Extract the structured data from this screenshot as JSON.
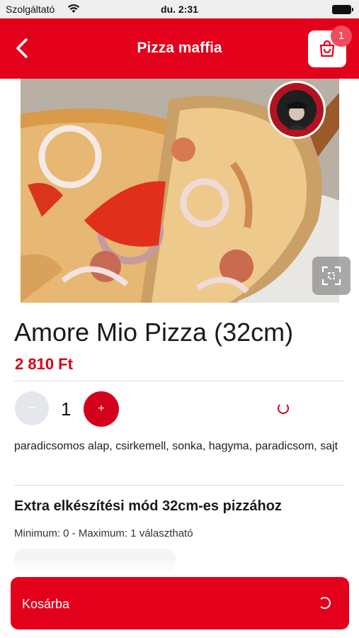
{
  "status_bar": {
    "carrier": "Szolgáltató",
    "time": "du. 2:31"
  },
  "header": {
    "title": "Pizza maffia",
    "cart_count": "1",
    "back_icon": "chevron-left-icon",
    "cart_icon": "shopping-bag-icon"
  },
  "product": {
    "name": "Amore Mio Pizza (32cm)",
    "price": "2 810 Ft",
    "quantity": "1",
    "minus_label": "−",
    "plus_label": "+",
    "description": "paradicsomos alap, csirkemell, sonka, hagyma, paradicsom, sajt"
  },
  "extras": {
    "title": "Extra elkészítési mód 32cm-es pizzához",
    "limits": "Minimum: 0 - Maximum: 1 választható"
  },
  "cta": {
    "label": "Kosárba"
  },
  "colors": {
    "brand_red": "#e2001a",
    "price_red": "#d5001c",
    "badge": "#f04c5e"
  }
}
